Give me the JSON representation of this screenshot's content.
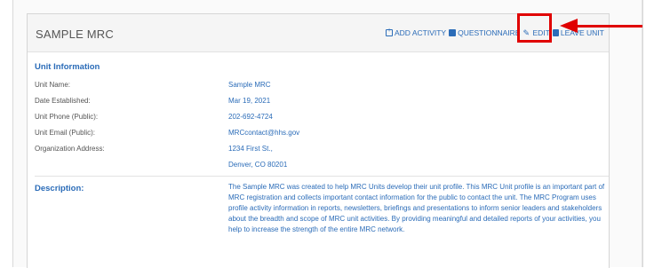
{
  "card": {
    "title": "SAMPLE MRC",
    "actions": [
      {
        "label": "ADD ACTIVITY",
        "icon": "add-activity-icon"
      },
      {
        "label": "QUESTIONNAIRE",
        "icon": "questionnaire-icon"
      },
      {
        "label": "EDIT",
        "icon": "edit-pencil-icon"
      },
      {
        "label": "LEAVE UNIT",
        "icon": "leave-unit-icon"
      }
    ]
  },
  "unit_info": {
    "heading": "Unit Information",
    "rows": [
      {
        "label": "Unit Name:",
        "value": "Sample MRC"
      },
      {
        "label": "Date Established:",
        "value": "Mar 19, 2021"
      },
      {
        "label": "Unit Phone (Public):",
        "value": "202-692-4724"
      },
      {
        "label": "Unit Email (Public):",
        "value": "MRCcontact@hhs.gov"
      },
      {
        "label": "Organization Address:",
        "value": "1234 First St.,"
      },
      {
        "label": "",
        "value": "Denver, CO 80201"
      }
    ]
  },
  "description": {
    "heading": "Description:",
    "text": "The Sample MRC was created to help MRC Units develop their unit profile. This MRC Unit profile is an important part of MRC registration and collects important contact information for the public to contact the unit. The MRC Program uses profile activity information in reports, newsletters, briefings and presentations to inform senior leaders and stakeholders about the breadth and scope of MRC unit activities. By providing meaningful and detailed reports of your activities, you help to increase the strength of the entire MRC network."
  },
  "annotation": {
    "color": "#e00000"
  },
  "colors": {
    "link": "#2b6cb8",
    "label": "#555555"
  }
}
